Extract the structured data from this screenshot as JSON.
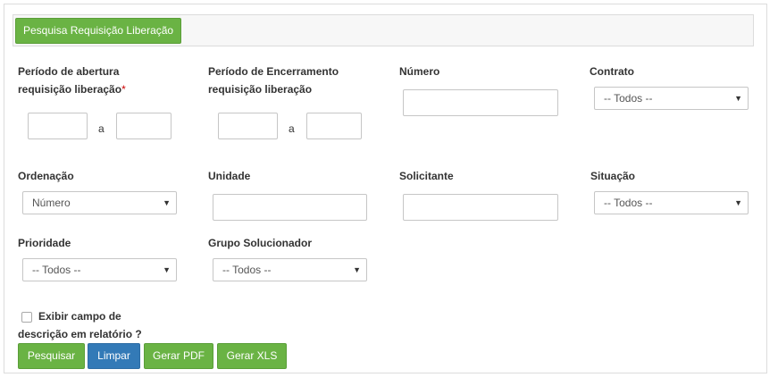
{
  "tab": {
    "label": "Pesquisa Requisição Liberação"
  },
  "fields": {
    "abertura": {
      "label_line1": "Período de abertura",
      "label_line2": "requisição liberação",
      "required_mark": "*",
      "separator": "a"
    },
    "encerramento": {
      "label_line1": "Período de Encerramento",
      "label_line2": "requisição liberação",
      "separator": "a"
    },
    "numero": {
      "label": "Número"
    },
    "contrato": {
      "label": "Contrato",
      "value": "-- Todos --"
    },
    "ordenacao": {
      "label": "Ordenação",
      "value": "Número"
    },
    "unidade": {
      "label": "Unidade"
    },
    "solicitante": {
      "label": "Solicitante"
    },
    "situacao": {
      "label": "Situação",
      "value": "-- Todos --"
    },
    "prioridade": {
      "label": "Prioridade",
      "value": "-- Todos --"
    },
    "grupo": {
      "label": "Grupo Solucionador",
      "value": "-- Todos --"
    },
    "descricao": {
      "label_line1": "Exibir campo de",
      "label_line2": "descrição em relatório ?",
      "checked": false
    }
  },
  "buttons": {
    "pesquisar": "Pesquisar",
    "limpar": "Limpar",
    "gerar_pdf": "Gerar PDF",
    "gerar_xls": "Gerar XLS"
  },
  "colors": {
    "green": "#6ab344",
    "blue": "#337ab7",
    "required": "#cc0000"
  },
  "icons": {
    "select_arrow": "▼"
  }
}
